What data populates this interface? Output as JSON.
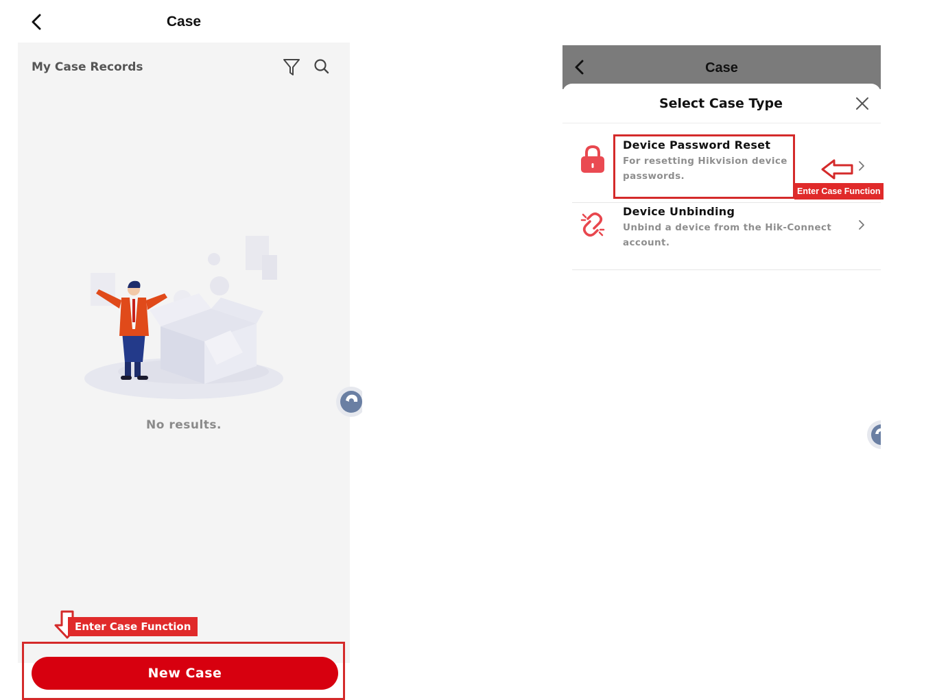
{
  "left_screen": {
    "header": {
      "title": "Case",
      "back_icon": "chevron-left-icon"
    },
    "records_label": "My Case Records",
    "toolbar_icons": [
      "filter-icon",
      "search-icon"
    ],
    "empty_state": {
      "illustration": "empty-box-person-illustration",
      "message": "No results."
    },
    "annotation": {
      "label": "Enter Case Function",
      "arrow": "arrow-down-icon"
    },
    "primary_button": {
      "label": "New Case"
    }
  },
  "right_screen": {
    "header": {
      "title": "Case",
      "back_icon": "chevron-left-icon"
    },
    "sheet": {
      "title": "Select Case Type",
      "close_icon": "close-icon",
      "options": [
        {
          "title": "Device Password Reset",
          "description": "For resetting Hikvision device passwords.",
          "icon": "lock-icon"
        },
        {
          "title": "Device Unbinding",
          "description": "Unbind a device from the Hik-Connect account.",
          "icon": "broken-link-icon"
        }
      ]
    },
    "annotation": {
      "label": "Enter Case Function",
      "arrow": "arrow-left-icon"
    }
  },
  "colors": {
    "brand_red": "#d7000f",
    "annotation_red": "#e02a2a",
    "header_gray": "#7b7b7b",
    "background_gray": "#f4f4f4"
  }
}
